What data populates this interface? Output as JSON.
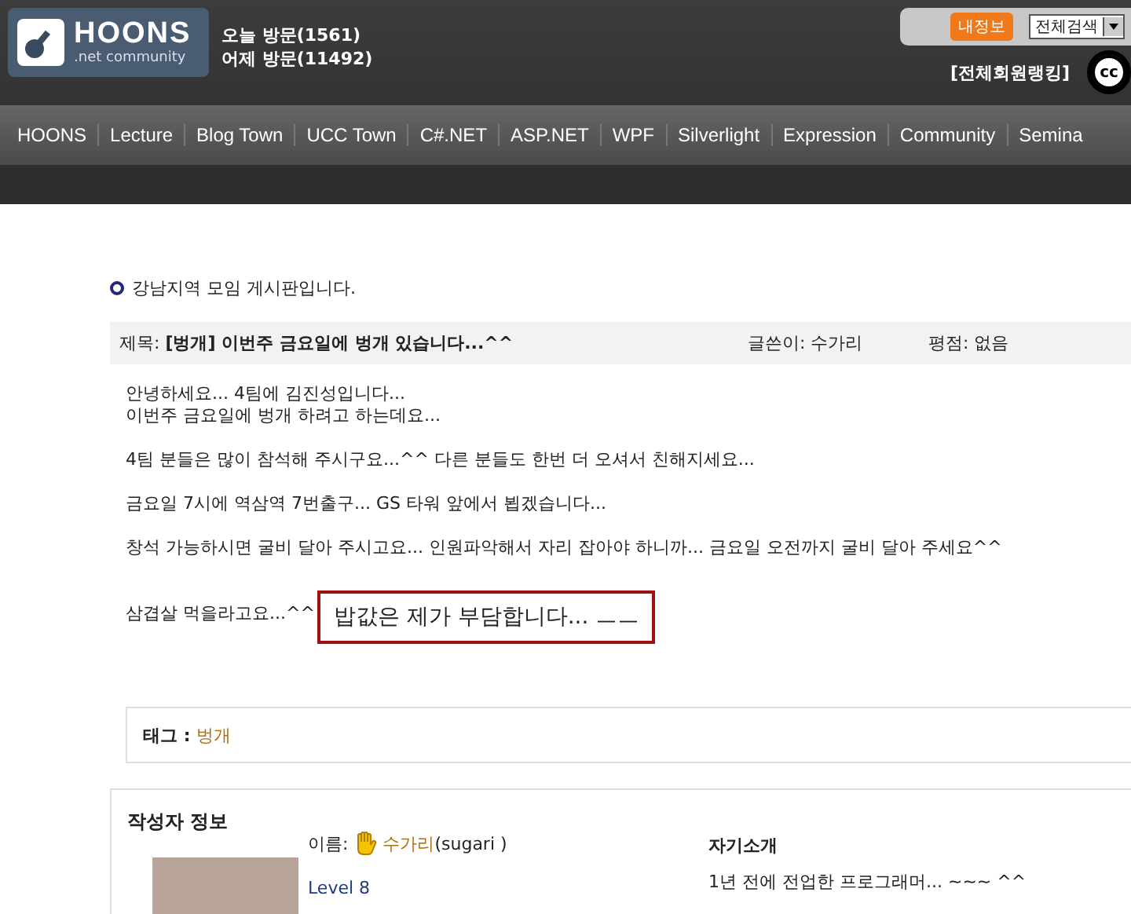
{
  "header": {
    "logo": {
      "name": "HOONS",
      "sub": ".net community"
    },
    "visits": [
      "오늘 방문(1561)",
      "어제 방문(11492)"
    ],
    "my_info_button": "내정보",
    "search_scope": "전체검색",
    "ranking_link": "[전체회원랭킹]",
    "cc_badge": "cc"
  },
  "nav": [
    "HOONS",
    "Lecture",
    "Blog Town",
    "UCC Town",
    "C#.NET",
    "ASP.NET",
    "WPF",
    "Silverlight",
    "Expression",
    "Community",
    "Semina"
  ],
  "board_title": "강남지역 모임 게시판입니다.",
  "post": {
    "subject_label": "제목:",
    "subject": "[벙개] 이번주 금요일에 벙개 있습니다...^^",
    "author_label": "글쓴이:",
    "author": "수가리",
    "rating_label": "평점:",
    "rating": "없음",
    "paragraphs": [
      {
        "lines": [
          "안녕하세요... 4팀에 김진성입니다...",
          "이번주 금요일에 벙개 하려고 하는데요..."
        ]
      },
      {
        "lines": [
          "4팀 분들은 많이 참석해 주시구요...^^ 다른 분들도 한번 더 오셔서 친해지세요..."
        ]
      },
      {
        "lines": [
          "금요일 7시에 역삼역 7번출구... GS 타워 앞에서 뵙겠습니다..."
        ]
      },
      {
        "lines": [
          "창석 가능하시면 굴비 달아 주시고요... 인원파악해서 자리 잡아야 하니까... 금요일 오전까지 굴비 달아 주세요^^"
        ]
      },
      {
        "lines": [
          "삼겹살 먹을라고요...^^"
        ],
        "callout": "밥값은 제가 부담합니다... ㅡㅡ"
      }
    ]
  },
  "tags": {
    "label": "태그 :",
    "tag": "벙개"
  },
  "author_info": {
    "title": "작성자 정보",
    "name_label": "이름:",
    "name": "수가리",
    "user_id": "(sugari )",
    "level": "Level 8",
    "intro_title": "자기소개",
    "intro": "1년 전에 전업한 프로그래머... ~~~ ^^"
  }
}
